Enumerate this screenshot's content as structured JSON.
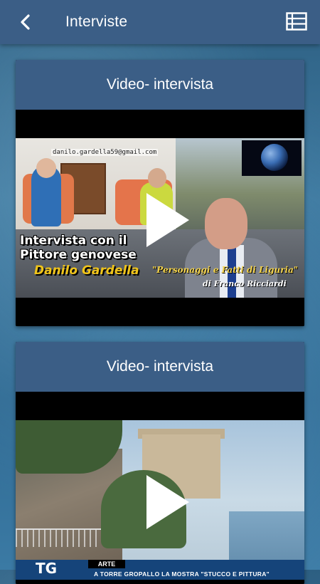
{
  "header": {
    "title": "Interviste",
    "back_icon": "chevron-left-icon",
    "menu_icon": "list-icon"
  },
  "cards": [
    {
      "title": "Video- intervista",
      "thumbnail": {
        "email": "danilo.gardella59@gmail.com",
        "caption_line1": "Intervista con il",
        "caption_line2": "Pittore genovese",
        "caption_name": "Danilo Gardella",
        "show_title": "\"Personaggi e Fatti di Liguria\"",
        "show_author": "di Franco Ricciardi"
      }
    },
    {
      "title": "Video- intervista",
      "thumbnail": {
        "logo": "TG",
        "tag": "ARTE",
        "ticker": "A TORRE GROPALLO LA MOSTRA \"STUCCO E PITTURA\""
      }
    }
  ],
  "colors": {
    "header_bg": "#3b5e86",
    "card_header_bg": "#3b5e86",
    "text": "#ffffff"
  }
}
